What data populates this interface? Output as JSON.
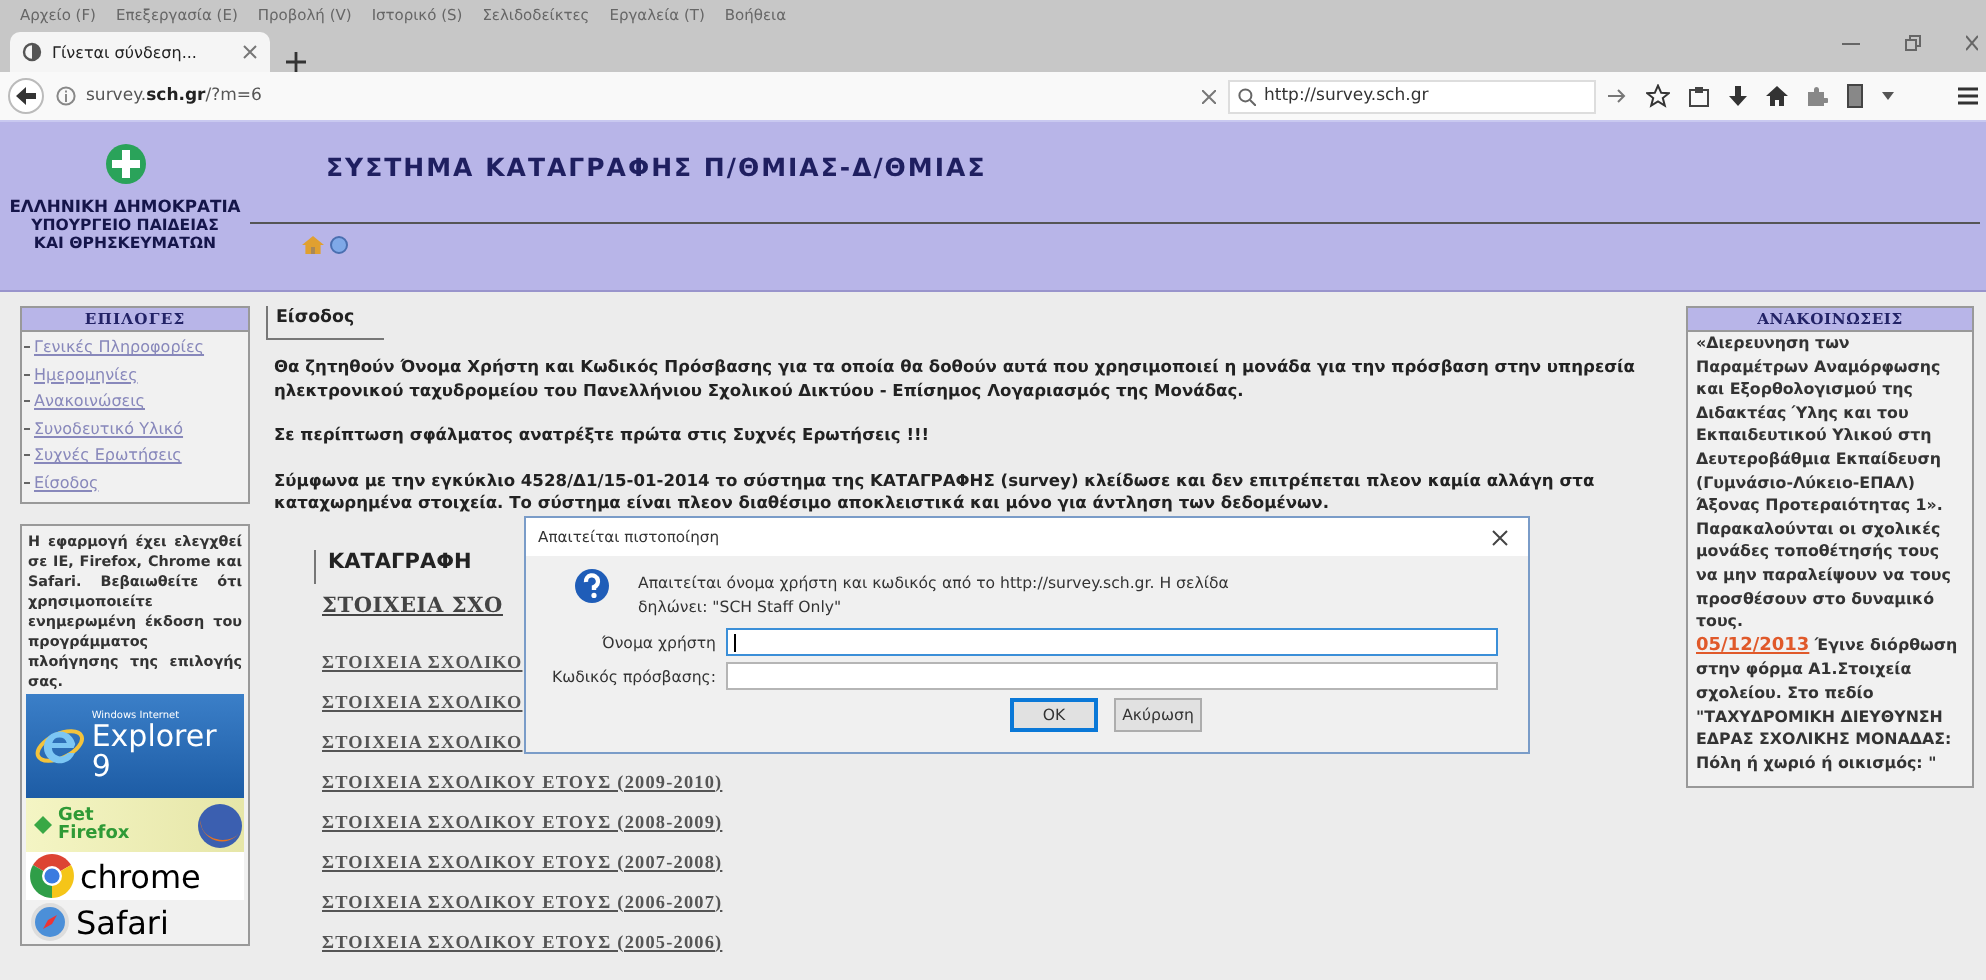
{
  "browser": {
    "menu": [
      "Αρχείο (F)",
      "Επεξεργασία (E)",
      "Προβολή (V)",
      "Ιστορικό (S)",
      "Σελιδοδείκτες",
      "Εργαλεία (T)",
      "Βοήθεια"
    ],
    "tab": {
      "title": "Γίνεται σύνδεση..."
    },
    "url": "survey.**sch.gr**/?m=6",
    "search": {
      "value": "http://survey.sch.gr"
    }
  },
  "header": {
    "logo_lines": [
      "ΕΛΛΗΝΙΚΗ ΔΗΜΟΚΡΑΤΙΑ",
      "ΥΠΟΥΡΓΕΙΟ ΠΑΙΔΕΙΑΣ",
      "ΚΑΙ ΘΡΗΣΚΕΥΜΑΤΩΝ"
    ],
    "title": "ΣΥΣΤΗΜΑ ΚΑΤΑΓΡΑΦΗΣ Π/ΘΜΙΑΣ-Δ/ΘΜΙΑΣ"
  },
  "sidebar": {
    "title": "ΕΠΙΛΟΓΕΣ",
    "items": [
      "Γενικές Πληροφορίες",
      "Ημερομηνίες",
      "Ανακοινώσεις",
      "Συνοδευτικό Υλικό",
      "Συχνές Ερωτήσεις",
      "Είσοδος"
    ],
    "notice": "Η εφαρμογή έχει ελεγχθεί σε IE, Firefox, Chrome και Safari. Βεβαιωθείτε ότι χρησιμοποιείτε ενημερωμένη έκδοση του προγράμματος πλοήγησης της επιλογής σας.",
    "badges": [
      {
        "kind": "ie",
        "lines": [
          "Windows Internet",
          "Explorer 9"
        ]
      },
      {
        "kind": "firefox",
        "lines": [
          "Get",
          "Firefox"
        ]
      },
      {
        "kind": "chrome",
        "lines": [
          "chrome"
        ]
      },
      {
        "kind": "safari",
        "lines": [
          "Safari"
        ]
      }
    ]
  },
  "main": {
    "heading": "Είσοδος",
    "paragraphs": [
      "Θα ζητηθούν Όνομα Χρήστη και Κωδικός Πρόσβασης για τα οποία θα δοθούν αυτά που χρησιμοποιεί η μονάδα για την πρόσβαση στην υπηρεσία ηλεκτρονικού ταχυδρομείου του Πανελλήνιου Σχολικού Δικτύου - Επίσημος Λογαριασμός της Μονάδας.",
      "Σε περίπτωση σφάλματος ανατρέξτε πρώτα στις Συχνές Ερωτήσεις !!!",
      "Σύμφωνα με την εγκύκλιο 4528/Δ1/15-01-2014 το σύστημα της ΚΑΤΑΓΡΑΦΗΣ (survey) κλείδωσε και δεν επιτρέπεται πλεον καμία αλλάγη στα καταχωρημένα στοιχεία. Το σύστημα είναι πλεον διαθέσιμο αποκλειστικά και μόνο για άντληση των δεδομένων."
    ],
    "section_title": "ΚΑΤΑΓΡΑΦΗ",
    "subsection_title": "ΣΤΟΙΧΕΙΑ ΣΧΟ",
    "links": [
      "ΣΤΟΙΧΕΙΑ ΣΧΟΛΙΚΟ",
      "ΣΤΟΙΧΕΙΑ ΣΧΟΛΙΚΟ",
      "ΣΤΟΙΧΕΙΑ ΣΧΟΛΙΚΟ",
      "ΣΤΟΙΧΕΙΑ ΣΧΟΛΙΚΟΥ ΕΤΟΥΣ (2009-2010)",
      "ΣΤΟΙΧΕΙΑ ΣΧΟΛΙΚΟΥ ΕΤΟΥΣ (2008-2009)",
      "ΣΤΟΙΧΕΙΑ ΣΧΟΛΙΚΟΥ ΕΤΟΥΣ (2007-2008)",
      "ΣΤΟΙΧΕΙΑ ΣΧΟΛΙΚΟΥ ΕΤΟΥΣ (2006-2007)",
      "ΣΤΟΙΧΕΙΑ ΣΧΟΛΙΚΟΥ ΕΤΟΥΣ (2005-2006)"
    ]
  },
  "announcements": {
    "title": "ΑΝΑΚΟΙΝΩΣΕΙΣ",
    "items": [
      {
        "text": "«Διερευνηση των Παραμέτρων Αναμόρφωσης και Εξορθολογισμού της Διδακτέας Ύλης και του Εκπαιδευτικού Υλικού στη Δευτεροβάθμια Εκπαίδευση (Γυμνάσιο-Λύκειο-ΕΠΑΛ) Άξονας Προτεραιότητας 1». Παρακαλούνται οι σχολικές μονάδες τοποθέτησής τους να μην παραλείψουν να τους προσθέσουν στο δυναμικό τους."
      },
      {
        "date": "05/12/2013",
        "text": "Έγινε διόρθωση στην φόρμα Α1.Στοιχεία σχολείου. Στο πεδίο \"ΤΑΧΥΔΡΟΜΙΚΗ ΔΙΕΥΘΥΝΣΗ ΕΔΡΑΣ ΣΧΟΛΙΚΗΣ ΜΟΝΑΔΑΣ: Πόλη ή χωριό ή οικισμός: \""
      }
    ]
  },
  "dialog": {
    "title": "Απαιτείται πιστοποίηση",
    "message": "Απαιτείται όνομα χρήστη και κωδικός από το http://survey.sch.gr. Η σελίδα δηλώνει: \"SCH Staff Only\"",
    "fields": [
      {
        "label": "Όνομα χρήστη",
        "focused": true
      },
      {
        "label": "Κωδικός πρόσβασης:",
        "focused": false
      }
    ],
    "buttons": [
      {
        "label": "OK",
        "default": true
      },
      {
        "label": "Ακύρωση",
        "default": false
      }
    ]
  }
}
